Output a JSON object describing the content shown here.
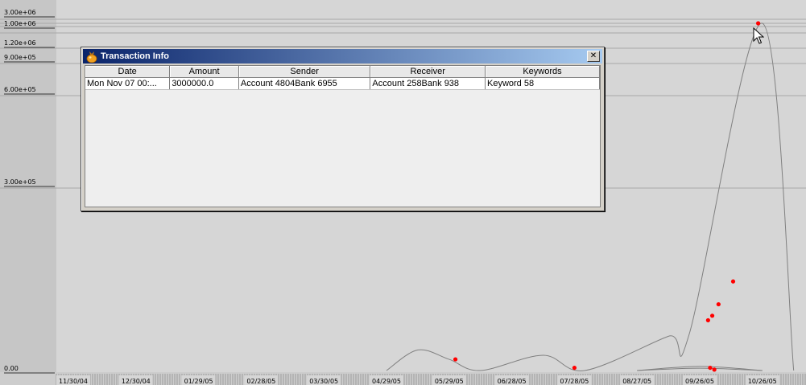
{
  "chart_data": {
    "type": "line",
    "y_ticks": [
      "3.00e+06",
      "1.00e+06",
      "1.20e+06",
      "9.00e+05",
      "6.00e+05",
      "3.00e+05",
      "0.00"
    ],
    "x_ticks": [
      "11/30/04",
      "12/30/04",
      "01/29/05",
      "02/28/05",
      "03/30/05",
      "04/29/05",
      "05/29/05",
      "06/28/05",
      "07/28/05",
      "08/27/05",
      "09/26/05",
      "10/26/05"
    ],
    "grid": "horizontal",
    "series": [
      {
        "color": "#808080",
        "points": [
          {
            "x": "04/29/05",
            "y": 0
          },
          {
            "x": "05/14/05",
            "y": 90000
          },
          {
            "x": "05/29/05",
            "y": 49000
          },
          {
            "x": "06/13/05",
            "y": 0
          },
          {
            "x": "07/13/05",
            "y": 67000
          },
          {
            "x": "08/02/05",
            "y": 0
          },
          {
            "x": "09/11/05",
            "y": 150000
          },
          {
            "x": "09/21/05",
            "y": 160000
          },
          {
            "x": "10/26/05",
            "y": 1520000
          },
          {
            "x": "11/10/05",
            "y": 0
          }
        ]
      },
      {
        "color": "#808080",
        "points": [
          {
            "x": "08/27/05",
            "y": 0
          },
          {
            "x": "09/26/05",
            "y": 18000
          },
          {
            "x": "10/26/05",
            "y": 0
          }
        ]
      },
      {
        "color": "#808080",
        "points": [
          {
            "x": "08/27/05",
            "y": 0
          },
          {
            "x": "09/26/05",
            "y": 10000
          },
          {
            "x": "10/26/05",
            "y": 0
          }
        ]
      }
    ],
    "highlighted_points": [
      {
        "x": "06/01/05",
        "y": 49000
      },
      {
        "x": "07/28/05",
        "y": 12000
      },
      {
        "x": "09/30/05",
        "y": 220000
      },
      {
        "x": "10/02/05",
        "y": 240000
      },
      {
        "x": "10/05/05",
        "y": 290000
      },
      {
        "x": "10/12/05",
        "y": 390000
      },
      {
        "x": "10/24/05",
        "y": 1520000
      },
      {
        "x": "10/01/05",
        "y": 12000
      },
      {
        "x": "10/03/05",
        "y": 4000
      }
    ],
    "point_color": "#ff0000"
  },
  "dialog": {
    "title": "Transaction Info",
    "close_symbol": "✕",
    "columns": [
      "Date",
      "Amount",
      "Sender",
      "Receiver",
      "Keywords"
    ],
    "rows": [
      [
        "Mon Nov 07 00:...",
        "3000000.0",
        "Account 4804Bank 6955",
        "Account 258Bank 938",
        "Keyword  58"
      ]
    ]
  },
  "icons": {
    "title_icon": "bag-icon",
    "cursor": "mouse-pointer-icon"
  }
}
